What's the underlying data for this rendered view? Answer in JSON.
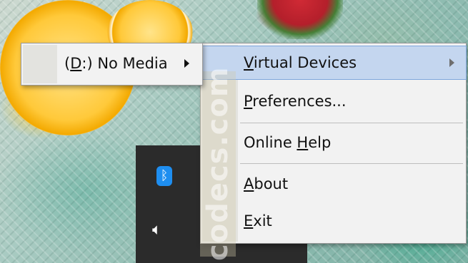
{
  "context_menu": {
    "items": [
      {
        "pre": "",
        "accel": "V",
        "post": "irtual Devices",
        "has_submenu": true,
        "highlighted": true
      },
      {
        "pre": "",
        "accel": "P",
        "post": "references...",
        "has_submenu": false,
        "highlighted": false
      },
      {
        "pre": "Online ",
        "accel": "H",
        "post": "elp",
        "has_submenu": false,
        "highlighted": false
      },
      {
        "pre": "",
        "accel": "A",
        "post": "bout",
        "has_submenu": false,
        "highlighted": false
      },
      {
        "pre": "",
        "accel": "E",
        "post": "xit",
        "has_submenu": false,
        "highlighted": false
      }
    ]
  },
  "submenu": {
    "item": {
      "pre": "(",
      "accel": "D",
      "post": ":) No Media",
      "has_submenu": true
    }
  },
  "watermark": {
    "text": "codecs.com"
  },
  "tray": {
    "bluetooth_icon": "bluetooth-icon",
    "volume_icon": "speaker-icon"
  },
  "colors": {
    "highlight": "#c4d6ef",
    "highlight_border": "#7ea6dc",
    "menu_bg": "#f2f2f2",
    "tray_bg": "#2b2b2b",
    "bluetooth": "#1e8ef0"
  }
}
